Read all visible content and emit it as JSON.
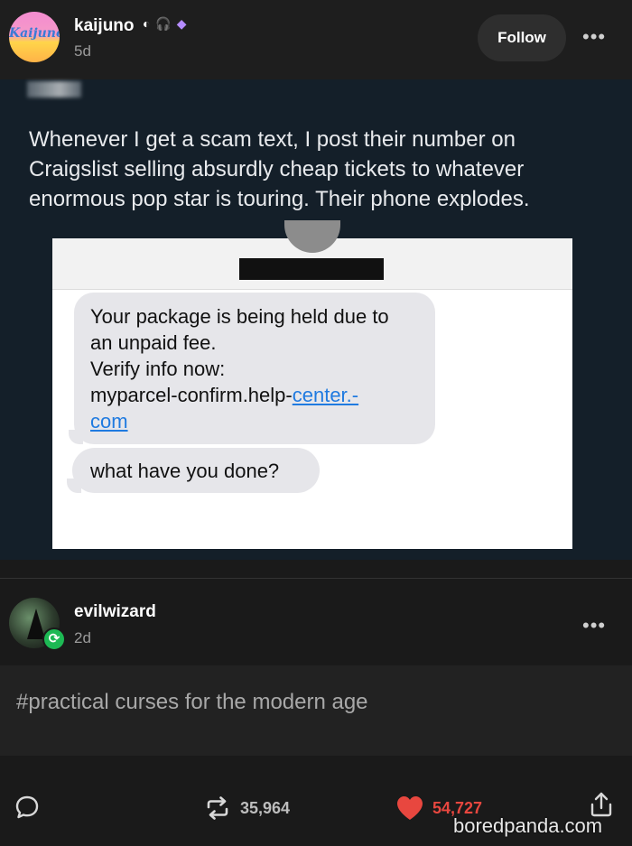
{
  "post": {
    "username": "kaijuno",
    "badges": [
      "◐",
      "🎧",
      "◆"
    ],
    "time": "5d",
    "follow_label": "Follow",
    "avatar_text": "Kaijuno",
    "more_label": "•••"
  },
  "tweet": {
    "text": "Whenever I get a scam text, I post their number on Craigslist selling absurdly cheap tickets to whatever enormous pop star is touring. Their phone explodes."
  },
  "messages": {
    "scam_line1": "Your package is being held due to",
    "scam_line2": "an unpaid fee.",
    "scam_line3": "Verify info now:",
    "scam_line4_plain": "myparcel-confirm.help-",
    "scam_line4_link": "center.-",
    "scam_line5_link": "com",
    "reply": "what have you done?"
  },
  "reblog": {
    "username": "evilwizard",
    "time": "2d",
    "more_label": "•••",
    "tag": "#practical curses for the modern age"
  },
  "actions": {
    "reblog_count": "35,964",
    "like_count": "54,727"
  },
  "watermark": "boredpanda.com",
  "colors": {
    "like": "#e8473f",
    "reblog_badge": "#1db954",
    "link": "#1f7ae0"
  },
  "icons": [
    "comment-icon",
    "reblog-icon",
    "heart-icon",
    "share-icon",
    "reblog-badge-icon"
  ]
}
